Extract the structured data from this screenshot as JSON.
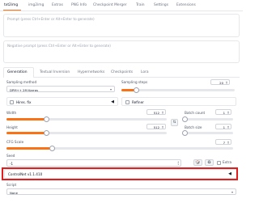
{
  "top_tabs": [
    "txt2img",
    "img2img",
    "Extras",
    "PNG Info",
    "Checkpoint Merger",
    "Train",
    "Settings",
    "Extensions"
  ],
  "prompt": {
    "placeholder": "Prompt (press Ctrl+Enter or Alt+Enter to generate)"
  },
  "negative_prompt": {
    "placeholder": "Negative prompt (press Ctrl+Enter or Alt+Enter to generate)"
  },
  "sub_tabs": [
    "Generation",
    "Textual Inversion",
    "Hypernetworks",
    "Checkpoints",
    "Lora"
  ],
  "sampling_method": {
    "label": "Sampling method",
    "value": "DPM++ 2M Karras"
  },
  "sampling_steps": {
    "label": "Sampling steps",
    "value": "20",
    "fraction": 0.13
  },
  "hires_fix": {
    "label": "Hires. fix"
  },
  "refiner": {
    "label": "Refiner"
  },
  "width": {
    "label": "Width",
    "value": "512",
    "fraction": 0.25
  },
  "height": {
    "label": "Height",
    "value": "512",
    "fraction": 0.25
  },
  "batch_count": {
    "label": "Batch count",
    "value": "1",
    "fraction": 0.0
  },
  "batch_size": {
    "label": "Batch size",
    "value": "1",
    "fraction": 0.0
  },
  "cfg_scale": {
    "label": "CFG Scale",
    "value": "7",
    "fraction": 0.2
  },
  "seed": {
    "label": "Seed",
    "value": "-1"
  },
  "extra": {
    "label": "Extra"
  },
  "controlnet": {
    "label": "ControlNet v1.1.410"
  },
  "script": {
    "label": "Script",
    "value": "None"
  },
  "colors": {
    "accent": "#f97316",
    "highlight": "#e11d1d"
  }
}
